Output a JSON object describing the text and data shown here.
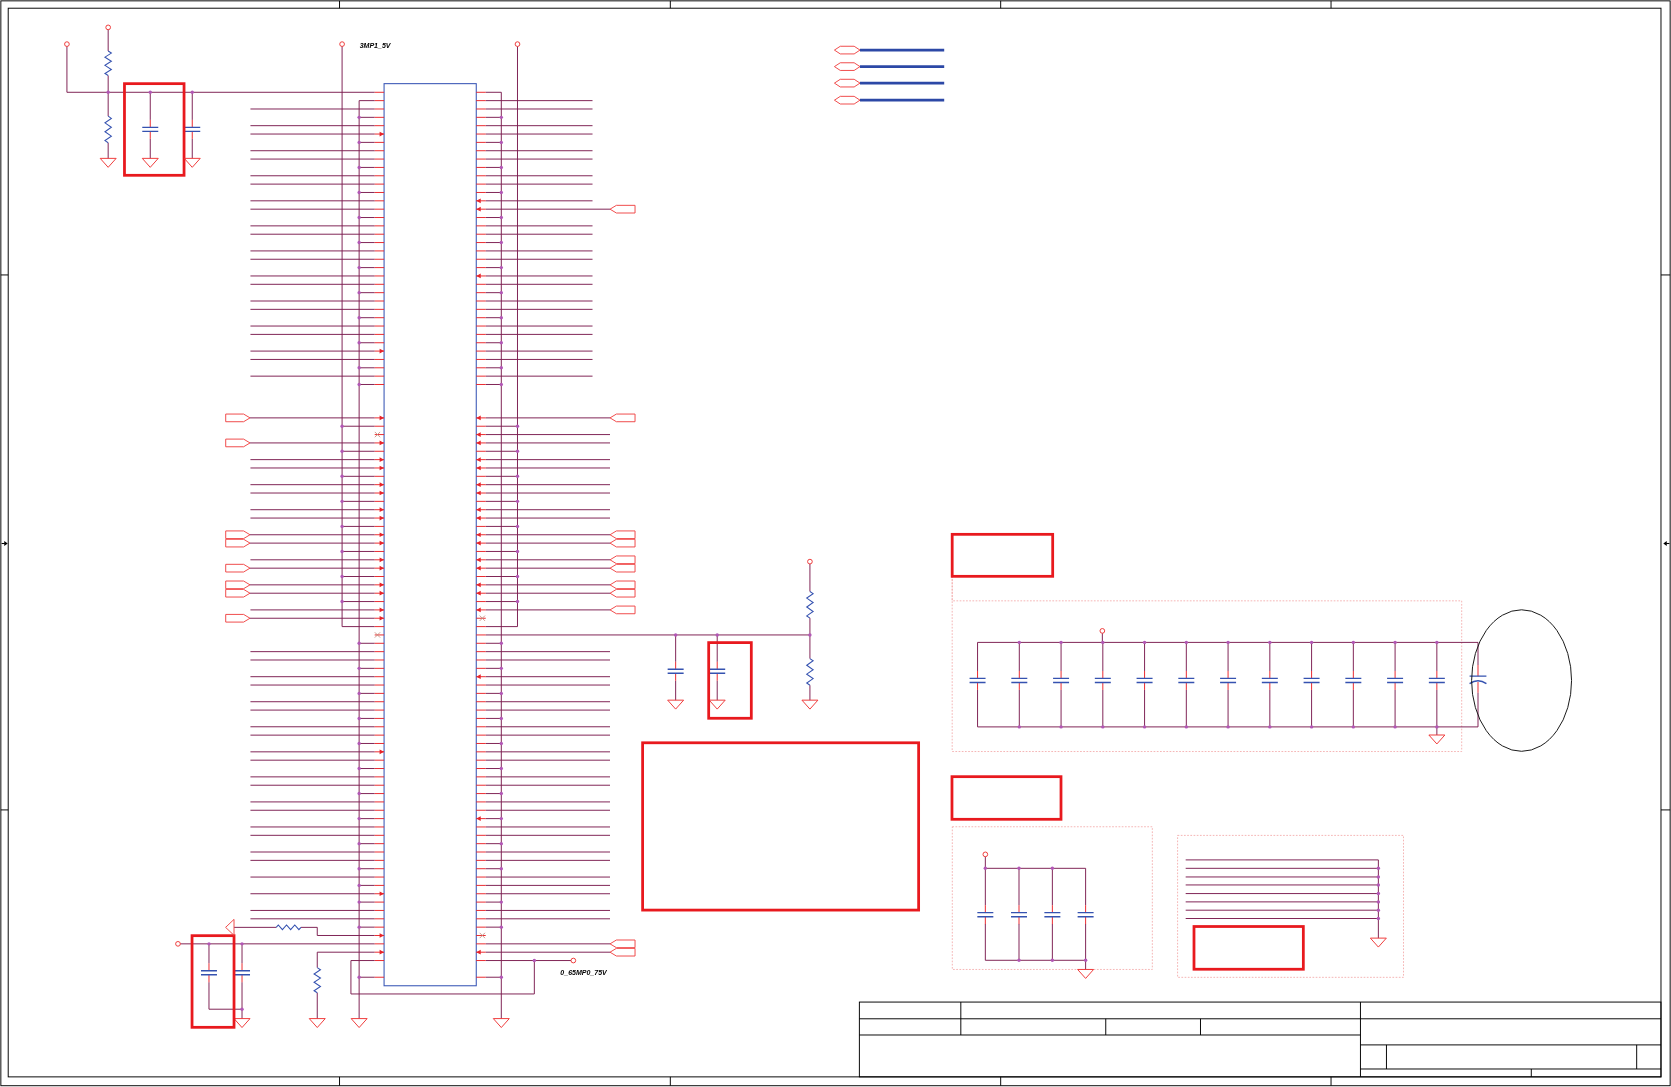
{
  "schematic": {
    "net_labels": [
      {
        "text": "3MP1_5V"
      },
      {
        "text": "0_65MP0_75V"
      }
    ]
  }
}
